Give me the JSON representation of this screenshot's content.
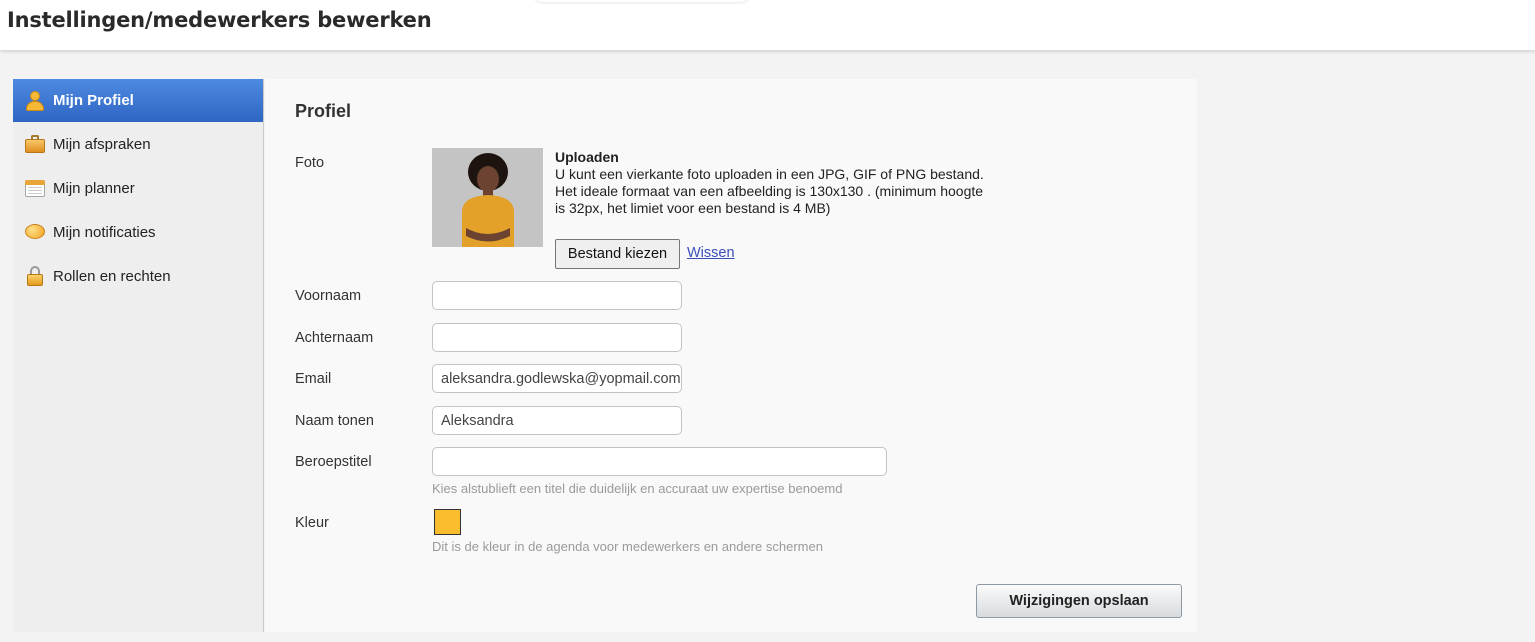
{
  "header": {
    "title": "Instellingen/medewerkers bewerken"
  },
  "sidebar": {
    "items": [
      {
        "label": "Mijn Profiel",
        "icon": "person-icon",
        "active": true
      },
      {
        "label": "Mijn afspraken",
        "icon": "briefcase-icon",
        "active": false
      },
      {
        "label": "Mijn planner",
        "icon": "calendar-icon",
        "active": false
      },
      {
        "label": "Mijn notificaties",
        "icon": "chat-bubble-icon",
        "active": false
      },
      {
        "label": "Rollen en rechten",
        "icon": "lock-icon",
        "active": false
      }
    ]
  },
  "profile": {
    "section_title": "Profiel",
    "photo": {
      "label": "Foto",
      "upload_title": "Uploaden",
      "upload_description": "U kunt een vierkante foto uploaden in een JPG, GIF of PNG bestand. Het ideale formaat van een afbeelding is 130x130 . (minimum hoogte is 32px, het limiet voor een bestand is 4 MB)",
      "choose_file_label": "Bestand kiezen",
      "clear_label": "Wissen"
    },
    "fields": {
      "first_name": {
        "label": "Voornaam",
        "value": ""
      },
      "last_name": {
        "label": "Achternaam",
        "value": ""
      },
      "email": {
        "label": "Email",
        "value": "aleksandra.godlewska@yopmail.com"
      },
      "display_name": {
        "label": "Naam tonen",
        "value": "Aleksandra"
      },
      "job_title": {
        "label": "Beroepstitel",
        "value": "",
        "hint": "Kies alstublieft een titel die duidelijk en accuraat uw expertise benoemd"
      },
      "color": {
        "label": "Kleur",
        "value": "#f9bd2e",
        "hint": "Dit is de kleur in de agenda voor medewerkers en andere schermen"
      }
    },
    "save_label": "Wijzigingen opslaan"
  },
  "colors": {
    "active_nav": "#3b74d4",
    "swatch": "#f9bd2e",
    "link": "#3b4fbb"
  }
}
